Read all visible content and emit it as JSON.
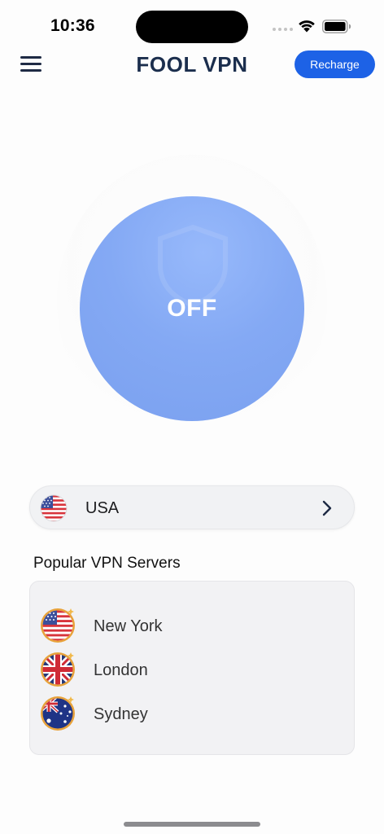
{
  "status_bar": {
    "time": "10:36"
  },
  "header": {
    "title": "FOOL VPN",
    "recharge_label": "Recharge"
  },
  "power": {
    "state_label": "OFF",
    "connected": false
  },
  "location": {
    "country": "USA",
    "flag_icon": "us-flag-icon"
  },
  "popular": {
    "title": "Popular VPN Servers",
    "servers": [
      {
        "name": "New York",
        "flag_icon": "us-flag-icon"
      },
      {
        "name": "London",
        "flag_icon": "uk-flag-icon"
      },
      {
        "name": "Sydney",
        "flag_icon": "au-flag-icon"
      }
    ]
  },
  "colors": {
    "accent": "#1d62e6",
    "title": "#1b2e4d",
    "toggle_off": "#84a9f4",
    "flag_ring": "#e8a23a"
  }
}
